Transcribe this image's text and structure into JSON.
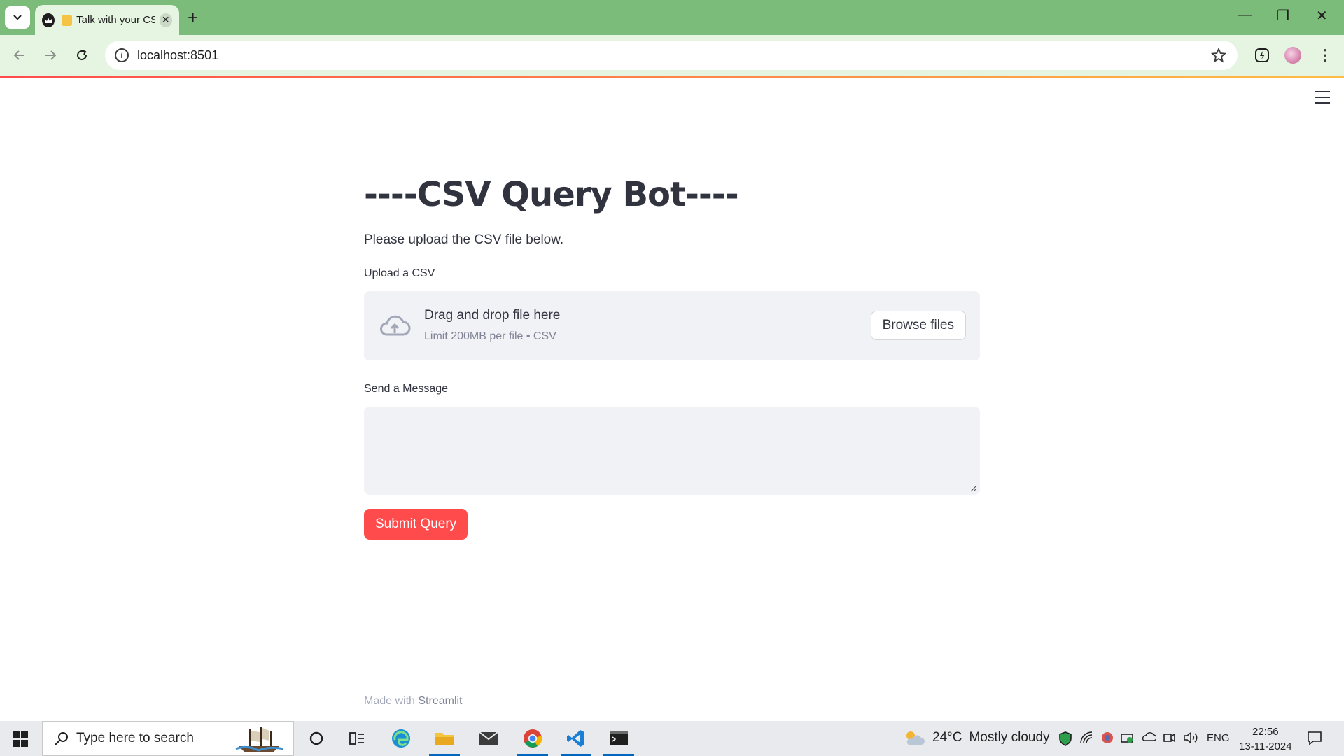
{
  "browser": {
    "tab_title": "Talk with your CSV",
    "url": "localhost:8501",
    "new_tab_symbol": "+",
    "tab_close_symbol": "✕",
    "minimize_symbol": "—",
    "restore_symbol": "❐",
    "close_symbol": "✕"
  },
  "app": {
    "title": "----CSV Query Bot----",
    "intro": "Please upload the CSV file below.",
    "uploader": {
      "label": "Upload a CSV",
      "drag_text": "Drag and drop file here",
      "limit_text": "Limit 200MB per file • CSV",
      "browse_label": "Browse files"
    },
    "message": {
      "label": "Send a Message",
      "value": ""
    },
    "submit_label": "Submit Query",
    "footer_prefix": "Made with ",
    "footer_brand": "Streamlit"
  },
  "taskbar": {
    "search_placeholder": "Type here to search",
    "weather_temp": "24°C",
    "weather_desc": "Mostly cloudy",
    "language": "ENG",
    "time": "22:56",
    "date": "13-11-2024"
  },
  "colors": {
    "tabbar": "#7cbc7a",
    "toolbar": "#e6f4e2",
    "primary": "#ff4b4b",
    "text": "#31333f",
    "widget_bg": "#f0f2f6"
  },
  "icons": {
    "tab_search": "chevron-down-icon",
    "back": "arrow-left-icon",
    "forward": "arrow-right-icon",
    "reload": "reload-icon",
    "site_info": "info-icon",
    "bookmark": "star-icon",
    "extension": "extension-icon",
    "menu": "kebab-menu-icon",
    "app_menu": "hamburger-icon",
    "upload": "cloud-upload-icon"
  }
}
